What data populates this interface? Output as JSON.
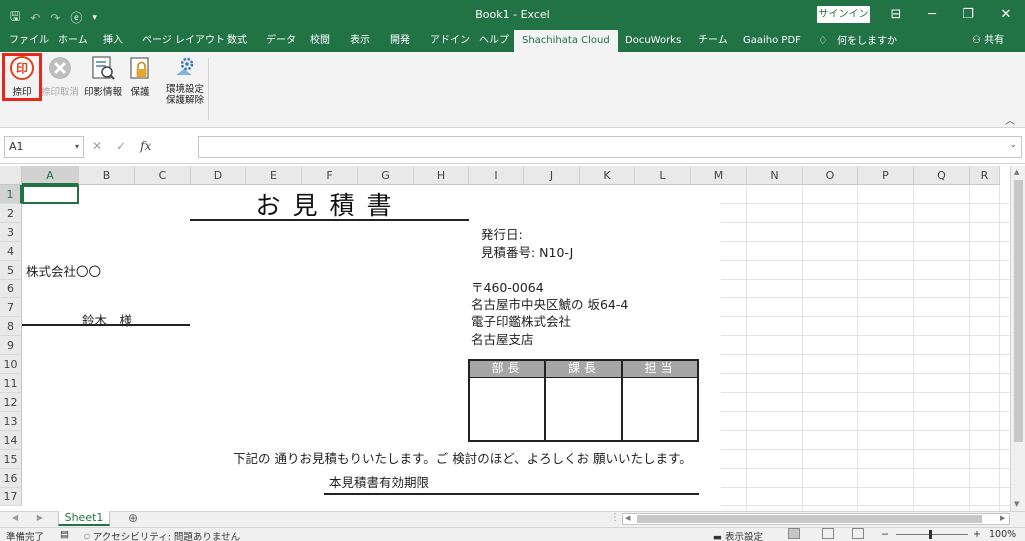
{
  "titlebar": {
    "qat": [
      "🖫",
      "↶",
      "↷",
      "ⓔ",
      "▾"
    ],
    "title": "Book1  -  Excel",
    "signin": "サインイン",
    "window_buttons": [
      "⊟",
      "─",
      "❐",
      "✕"
    ]
  },
  "tabs": [
    {
      "label": "ファイル",
      "active": false
    },
    {
      "label": "ホーム",
      "active": false
    },
    {
      "label": "挿入",
      "active": false
    },
    {
      "label": "ページ レイアウト",
      "active": false
    },
    {
      "label": "数式",
      "active": false
    },
    {
      "label": "データ",
      "active": false
    },
    {
      "label": "校閲",
      "active": false
    },
    {
      "label": "表示",
      "active": false
    },
    {
      "label": "開発",
      "active": false
    },
    {
      "label": "アドイン",
      "active": false
    },
    {
      "label": "ヘルプ",
      "active": false
    },
    {
      "label": "Shachihata Cloud",
      "active": true
    },
    {
      "label": "DocuWorks",
      "active": false
    },
    {
      "label": "チーム",
      "active": false
    },
    {
      "label": "Gaaiho PDF",
      "active": false
    }
  ],
  "tellme": {
    "icon": "lightbulb-icon",
    "label": "何をしますか"
  },
  "share": {
    "icon": "person-icon",
    "label": "共有"
  },
  "ribbon": {
    "buttons": [
      {
        "name": "stamp",
        "label": "捺印",
        "icon": "stamp-icon",
        "enabled": true
      },
      {
        "name": "cancel-stamp",
        "label": "捺印取消",
        "icon": "cancel-icon",
        "enabled": false
      },
      {
        "name": "stamp-info",
        "label": "印影情報",
        "icon": "stamp-info-icon",
        "enabled": true
      },
      {
        "name": "protect",
        "label": "保護",
        "icon": "lock-icon",
        "enabled": true
      },
      {
        "name": "settings",
        "label": "環境設定",
        "label2": "保護解除",
        "icon": "gear-icon",
        "enabled": true
      }
    ],
    "collapse": "︿"
  },
  "formula_bar": {
    "namebox": "A1",
    "cancel": "✕",
    "enter": "✓",
    "fx": "fx",
    "value": ""
  },
  "columns": [
    "A",
    "B",
    "C",
    "D",
    "E",
    "F",
    "G",
    "H",
    "I",
    "J",
    "K",
    "L",
    "M",
    "N",
    "O",
    "P",
    "Q",
    "R"
  ],
  "rows": [
    "1",
    "2",
    "3",
    "4",
    "5",
    "6",
    "7",
    "8",
    "9",
    "10",
    "11",
    "12",
    "13",
    "14",
    "15",
    "16",
    "17"
  ],
  "sheet": {
    "title": "お見積書",
    "issue_date_label": "発行日:",
    "quote_number": "見積番号: N10-J",
    "client_company": "株式会社〇〇",
    "client_person": "鈴木　様",
    "postal": "〒460-0064",
    "address": "名古屋市中央区鯱の 坂64-4",
    "company": "電子印鑑株式会社",
    "branch": "名古屋支店",
    "approval_headers": [
      "部長",
      "課長",
      "担当"
    ],
    "message": "下記の 通りお見積もりいたします。ご 検討のほど、よろしくお 願いいたします。",
    "validity": "本見積書有効期限"
  },
  "sheet_tabs": {
    "nav": "◀ ▶",
    "active": "Sheet1",
    "add": "⊕"
  },
  "status": {
    "ready": "準備完了",
    "accessibility": "アクセシビリティ: 問題ありません",
    "display_settings": "表示設定",
    "zoom_minus": "−",
    "zoom_plus": "+",
    "zoom": "100%"
  }
}
